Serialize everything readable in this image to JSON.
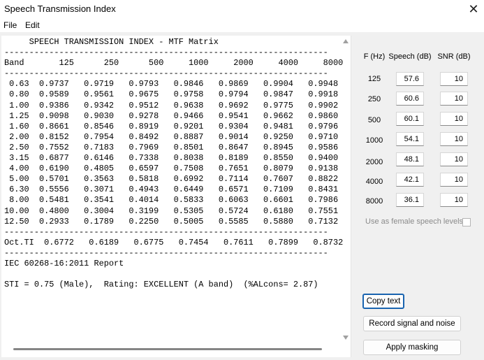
{
  "window": {
    "title": "Speech Transmission Index",
    "close_glyph": "✕"
  },
  "menu": [
    "File",
    "Edit"
  ],
  "report": {
    "lines": [
      "     SPEECH TRANSMISSION INDEX - MTF Matrix",
      "-----------------------------------------------------------------",
      "Band       125      250      500     1000     2000     4000     8000",
      "-----------------------------------------------------------------",
      " 0.63  0.9737   0.9719   0.9793   0.9846   0.9869   0.9904   0.9948",
      " 0.80  0.9589   0.9561   0.9675   0.9758   0.9794   0.9847   0.9918",
      " 1.00  0.9386   0.9342   0.9512   0.9638   0.9692   0.9775   0.9902",
      " 1.25  0.9098   0.9030   0.9278   0.9466   0.9541   0.9662   0.9860",
      " 1.60  0.8661   0.8546   0.8919   0.9201   0.9304   0.9481   0.9796",
      " 2.00  0.8152   0.7954   0.8492   0.8887   0.9014   0.9250   0.9710",
      " 2.50  0.7552   0.7183   0.7969   0.8501   0.8647   0.8945   0.9586",
      " 3.15  0.6877   0.6146   0.7338   0.8038   0.8189   0.8550   0.9400",
      " 4.00  0.6190   0.4805   0.6597   0.7508   0.7651   0.8079   0.9138",
      " 5.00  0.5701   0.3563   0.5818   0.6992   0.7114   0.7607   0.8822",
      " 6.30  0.5556   0.3071   0.4943   0.6449   0.6571   0.7109   0.8431",
      " 8.00  0.5481   0.3541   0.4014   0.5833   0.6063   0.6601   0.7986",
      "10.00  0.4800   0.3004   0.3199   0.5305   0.5724   0.6180   0.7551",
      "12.50  0.2933   0.1789   0.2250   0.5005   0.5585   0.5880   0.7132",
      "-----------------------------------------------------------------",
      "Oct.TI  0.6772   0.6189   0.6775   0.7454   0.7611   0.7899   0.8732",
      "-----------------------------------------------------------------",
      "IEC 60268-16:2011 Report",
      "",
      "STI = 0.75 (Male),  Rating: EXCELLENT (A band)  (%ALcons= 2.87)"
    ]
  },
  "params": {
    "headers": {
      "freq": "F (Hz)",
      "speech": "Speech (dB)",
      "snr": "SNR (dB)"
    },
    "rows": [
      {
        "freq": "125",
        "speech": "57.6",
        "snr": "10"
      },
      {
        "freq": "250",
        "speech": "60.6",
        "snr": "10"
      },
      {
        "freq": "500",
        "speech": "60.1",
        "snr": "10"
      },
      {
        "freq": "1000",
        "speech": "54.1",
        "snr": "10"
      },
      {
        "freq": "2000",
        "speech": "48.1",
        "snr": "10"
      },
      {
        "freq": "4000",
        "speech": "42.1",
        "snr": "10"
      },
      {
        "freq": "8000",
        "speech": "36.1",
        "snr": "10"
      }
    ],
    "female_label": "Use as female speech levels",
    "female_checked": false
  },
  "buttons": {
    "copy": "Copy text",
    "record": "Record signal and noise",
    "mask": "Apply masking"
  }
}
